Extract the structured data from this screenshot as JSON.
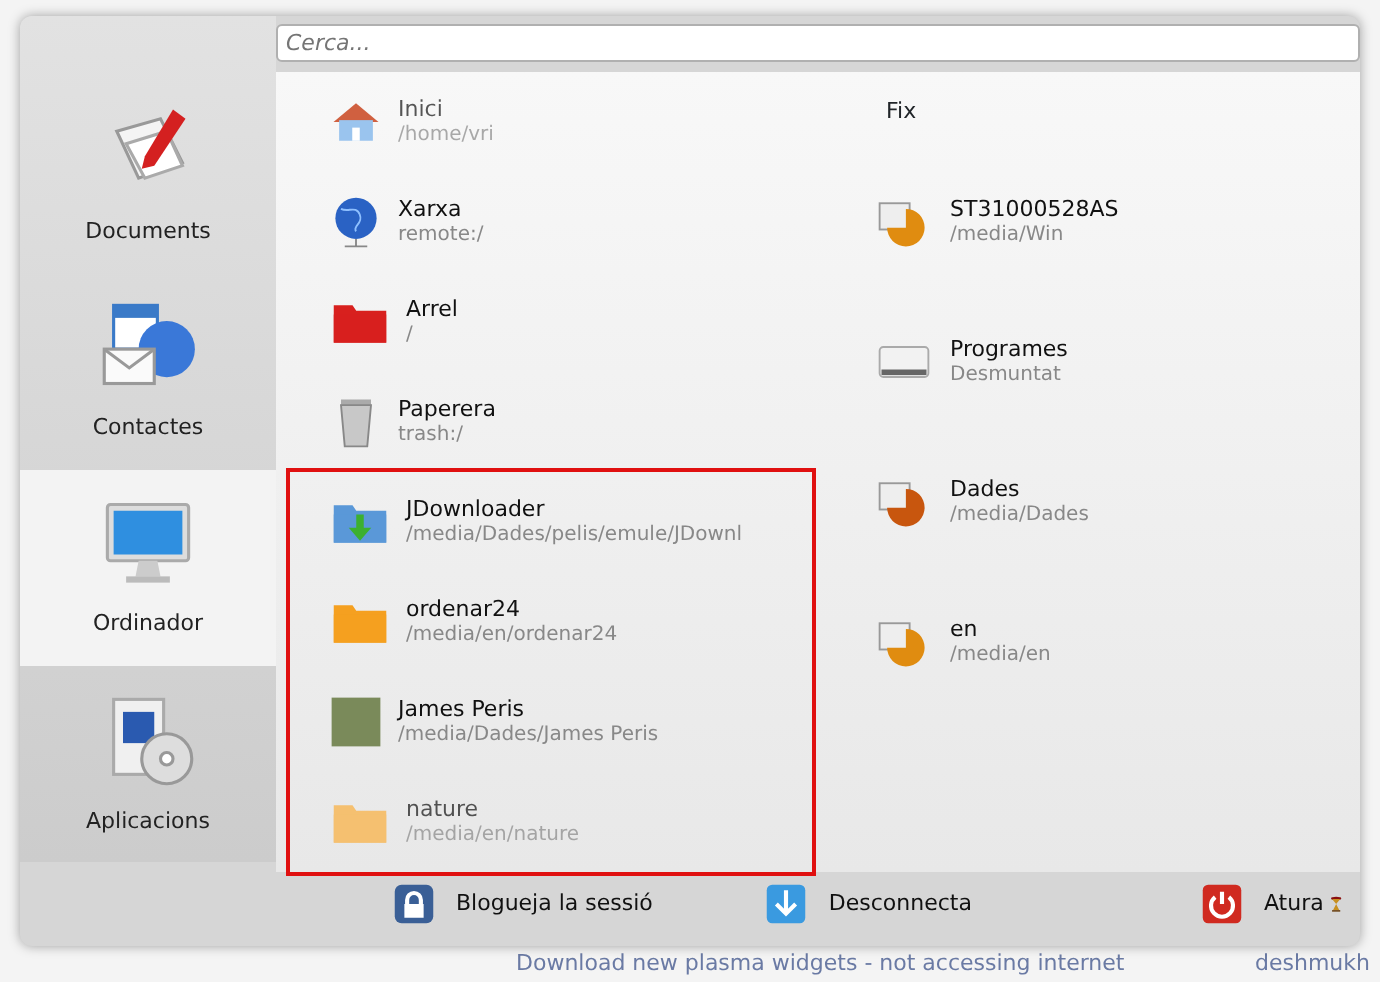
{
  "background": {
    "bottom_text": "Download new plasma widgets - not accessing internet",
    "bottom_user": "deshmukh"
  },
  "search": {
    "placeholder": "Cerca..."
  },
  "sidebar": {
    "items": [
      {
        "label": "Documents",
        "kind": "documents",
        "selected": false
      },
      {
        "label": "Contactes",
        "kind": "contacts",
        "selected": false
      },
      {
        "label": "Ordinador",
        "kind": "computer",
        "selected": true
      },
      {
        "label": "Aplicacions",
        "kind": "applications",
        "selected": false
      }
    ]
  },
  "places": [
    {
      "name": "Inici",
      "path": "/home/vri",
      "kind": "house",
      "faded": true,
      "highlighted": false
    },
    {
      "name": "Xarxa",
      "path": "remote:/",
      "kind": "globe",
      "faded": false,
      "highlighted": false
    },
    {
      "name": "Arrel",
      "path": "/",
      "kind": "folder",
      "color": "#d8201e",
      "faded": false,
      "highlighted": false
    },
    {
      "name": "Paperera",
      "path": "trash:/",
      "kind": "trash",
      "faded": false,
      "highlighted": false
    },
    {
      "name": "JDownloader",
      "path": "/media/Dades/pelis/emule/JDownl",
      "kind": "download-folder",
      "faded": false,
      "highlighted": true
    },
    {
      "name": "ordenar24",
      "path": "/media/en/ordenar24",
      "kind": "folder",
      "color": "#f5a020",
      "faded": false,
      "highlighted": true
    },
    {
      "name": "James Peris",
      "path": "/media/Dades/James Peris",
      "kind": "photo",
      "faded": false,
      "highlighted": true
    },
    {
      "name": "nature",
      "path": "/media/en/nature",
      "kind": "folder",
      "color": "#f5c070",
      "faded": true,
      "highlighted": true
    }
  ],
  "storage": {
    "heading": "Fix",
    "items": [
      {
        "name": "ST31000528AS",
        "detail": "/media/Win",
        "mounted": true,
        "color": "#e08c10"
      },
      {
        "name": "Programes",
        "detail": "Desmuntat",
        "mounted": false
      },
      {
        "name": "Dades",
        "detail": "/media/Dades",
        "mounted": true,
        "color": "#c8560e"
      },
      {
        "name": "en",
        "detail": "/media/en",
        "mounted": true,
        "color": "#e08c10"
      }
    ]
  },
  "actions": [
    {
      "label": "Blogueja la sessió",
      "kind": "lock"
    },
    {
      "label": "Desconnecta",
      "kind": "logout"
    },
    {
      "label": "Atura",
      "kind": "power"
    }
  ]
}
